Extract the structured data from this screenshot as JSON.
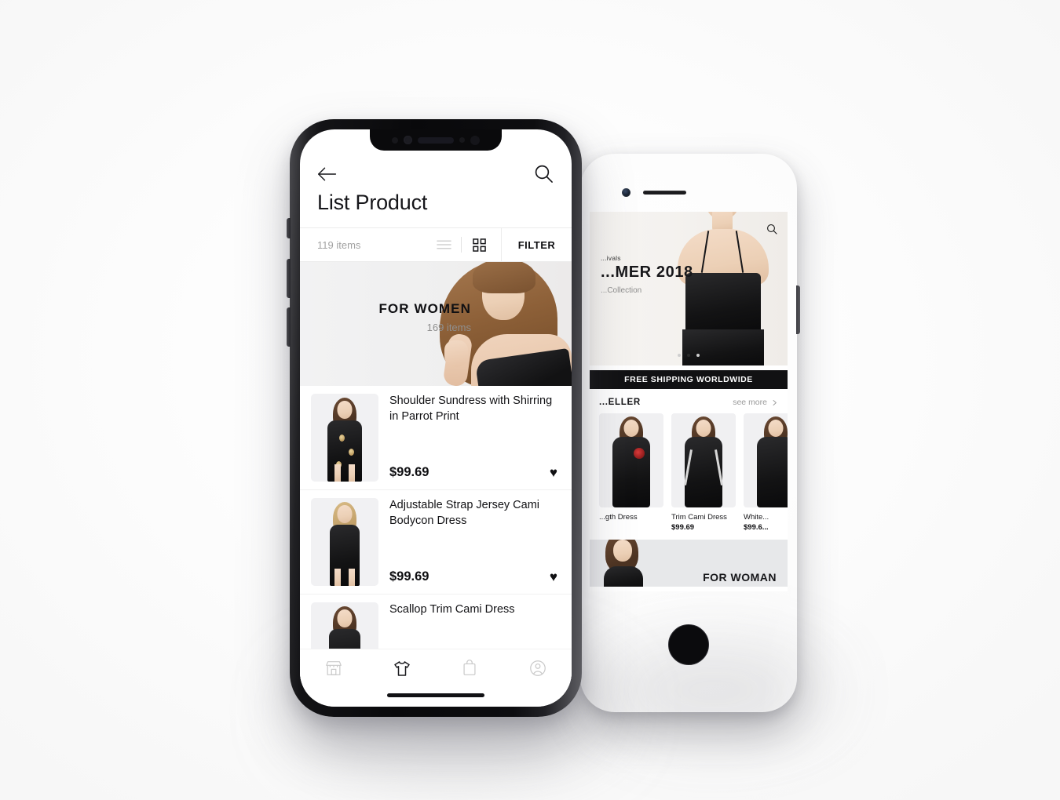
{
  "scene": {
    "background_color": "#fafafa"
  },
  "front_phone": {
    "device": "iphone-x",
    "app": {
      "header": {
        "back_icon": "arrow-left-icon",
        "search_icon": "search-icon",
        "page_title": "List Product"
      },
      "toolbar": {
        "item_count": "119 items",
        "list_view_icon": "list-view-icon",
        "grid_view_icon": "grid-view-icon",
        "active_view": "grid",
        "filter_label": "FILTER"
      },
      "category_banner": {
        "title": "FOR WOMEN",
        "subtitle": "169 items"
      },
      "products": [
        {
          "name": "Shoulder Sundress with Shirring in Parrot Print",
          "price": "$99.69",
          "favorite_icon": "heart-icon",
          "favorited": true
        },
        {
          "name": "Adjustable Strap Jersey Cami Bodycon Dress",
          "price": "$99.69",
          "favorite_icon": "heart-icon",
          "favorited": true
        },
        {
          "name": "Scallop Trim Cami Dress",
          "price": "",
          "favorite_icon": "heart-icon",
          "favorited": false
        }
      ],
      "bottom_nav": [
        {
          "icon": "store-icon",
          "active": false
        },
        {
          "icon": "tshirt-icon",
          "active": true
        },
        {
          "icon": "shopping-bag-icon",
          "active": false
        },
        {
          "icon": "user-profile-icon",
          "active": false
        }
      ]
    }
  },
  "back_phone": {
    "device": "iphone-8",
    "app": {
      "hero": {
        "kicker": "...ivals",
        "title": "...MER 2018",
        "subtitle": "...Collection",
        "search_icon": "search-icon",
        "carousel_dots": 3,
        "active_dot": 2
      },
      "promo_strip": "FREE SHIPPING WORLDWIDE",
      "section": {
        "title": "...ELLER",
        "see_more_label": "see more",
        "chevron_icon": "chevron-right-icon"
      },
      "cards": [
        {
          "name": "...gth Dress",
          "price": ""
        },
        {
          "name": "Trim Cami Dress",
          "price": "$99.69"
        },
        {
          "name": "White...",
          "price": "$99.6..."
        }
      ],
      "bottom_banner": {
        "label": "FOR WOMAN"
      }
    }
  }
}
